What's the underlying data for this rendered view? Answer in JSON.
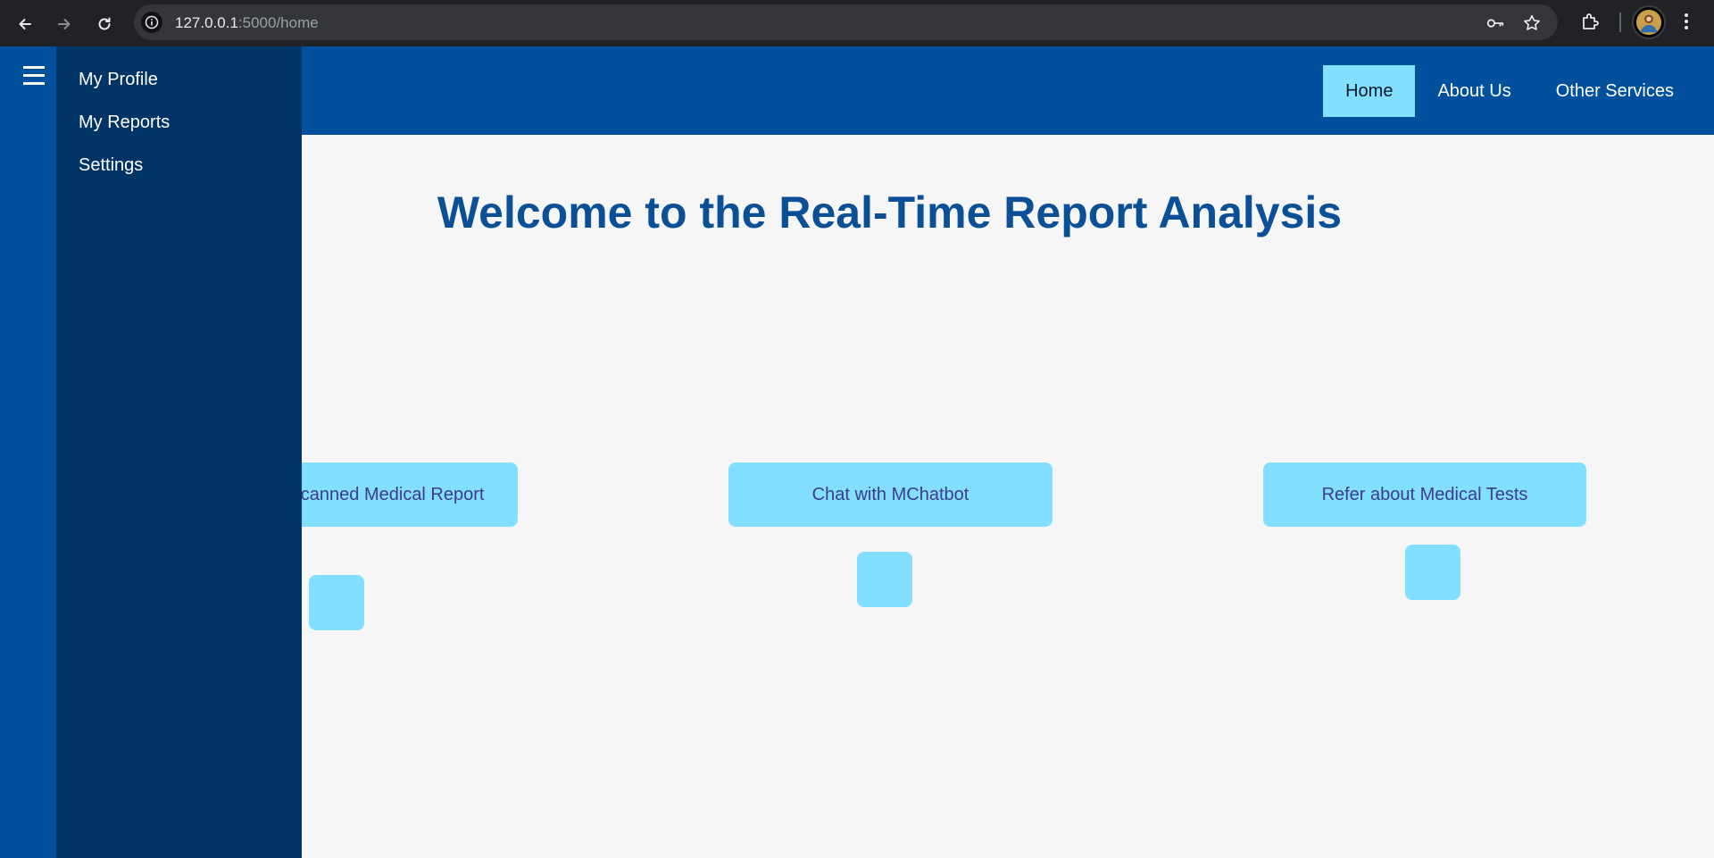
{
  "browser": {
    "url_host": "127.0.0.1",
    "url_path": ":5000/home",
    "icons": [
      "back-arrow-icon",
      "forward-arrow-icon",
      "reload-icon",
      "site-info-icon",
      "password-key-icon",
      "bookmark-star-icon",
      "extensions-icon",
      "profile-avatar",
      "more-menu-icon"
    ]
  },
  "sidebar": {
    "items": [
      {
        "label": "My Profile"
      },
      {
        "label": "My Reports"
      },
      {
        "label": "Settings"
      }
    ]
  },
  "nav": {
    "items": [
      {
        "label": "Home",
        "active": true
      },
      {
        "label": "About Us",
        "active": false
      },
      {
        "label": "Other Services",
        "active": false
      }
    ]
  },
  "main": {
    "title": "Welcome to the Real-Time Report Analysis",
    "cards": [
      {
        "label": "Upload Scanned Medical Report"
      },
      {
        "label": "Chat with MChatbot"
      },
      {
        "label": "Refer about Medical Tests"
      }
    ]
  },
  "colors": {
    "header": "#00509e",
    "sidebar": "#003366",
    "accent": "#82dfff",
    "title": "#0b4f96",
    "background": "#f6f6f7"
  }
}
